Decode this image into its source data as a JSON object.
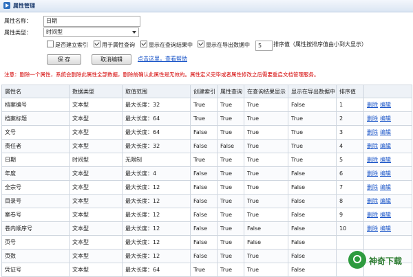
{
  "window": {
    "title": "属性管理"
  },
  "form": {
    "name_label": "属性名称：",
    "name_value": "日期",
    "type_label": "属性类型：",
    "type_value": "时间型",
    "options": [
      {
        "label": "是否建立索引",
        "checked": false
      },
      {
        "label": "用于属性查询",
        "checked": true
      },
      {
        "label": "显示在查询结果中",
        "checked": true
      },
      {
        "label": "显示在导出数据中",
        "checked": true
      }
    ],
    "sort_value": "5",
    "sort_hint": "排序值（属性按排序值由小到大显示）",
    "save_label": "保 存",
    "cancel_label": "取消编辑",
    "help_link": "点击这里，查看帮助"
  },
  "notice": "注意：删除一个属性，系统会删除此属性全部数据，删除前确认此属性是无效的。属性定义完毕或者属性修改之后需要重启文档管理服务。",
  "table": {
    "headers": [
      "属性名",
      "数据类型",
      "取值范围",
      "创建索引",
      "属性查询",
      "在查询结果显示",
      "显示在导出数据中",
      "排序值",
      ""
    ],
    "rows": [
      [
        "档案编号",
        "文本型",
        "最大长度：32",
        "True",
        "True",
        "True",
        "False",
        "1"
      ],
      [
        "档案标题",
        "文本型",
        "最大长度：64",
        "True",
        "True",
        "True",
        "True",
        "2"
      ],
      [
        "文号",
        "文本型",
        "最大长度：64",
        "False",
        "True",
        "True",
        "True",
        "3"
      ],
      [
        "责任者",
        "文本型",
        "最大长度：32",
        "False",
        "False",
        "True",
        "True",
        "4"
      ],
      [
        "日期",
        "时间型",
        "无限制",
        "True",
        "True",
        "True",
        "True",
        "5"
      ],
      [
        "年度",
        "文本型",
        "最大长度：4",
        "False",
        "True",
        "True",
        "False",
        "6"
      ],
      [
        "全宗号",
        "文本型",
        "最大长度：12",
        "False",
        "True",
        "True",
        "False",
        "7"
      ],
      [
        "目录号",
        "文本型",
        "最大长度：12",
        "False",
        "True",
        "True",
        "False",
        "8"
      ],
      [
        "案卷号",
        "文本型",
        "最大长度：12",
        "False",
        "True",
        "True",
        "False",
        "9"
      ],
      [
        "卷内顺序号",
        "文本型",
        "最大长度：12",
        "False",
        "True",
        "False",
        "False",
        "10"
      ],
      [
        "页号",
        "文本型",
        "最大长度：12",
        "False",
        "True",
        "False",
        "False",
        ""
      ],
      [
        "页数",
        "文本型",
        "最大长度：12",
        "False",
        "True",
        "True",
        "False",
        ""
      ],
      [
        "凭证号",
        "文本型",
        "最大长度：64",
        "True",
        "True",
        "True",
        "False",
        ""
      ]
    ],
    "action_delete": "删除",
    "action_edit": "编辑",
    "action_rows": 10
  },
  "watermark": {
    "text": "神奇下载",
    "icon": "watermark-logo-icon"
  }
}
